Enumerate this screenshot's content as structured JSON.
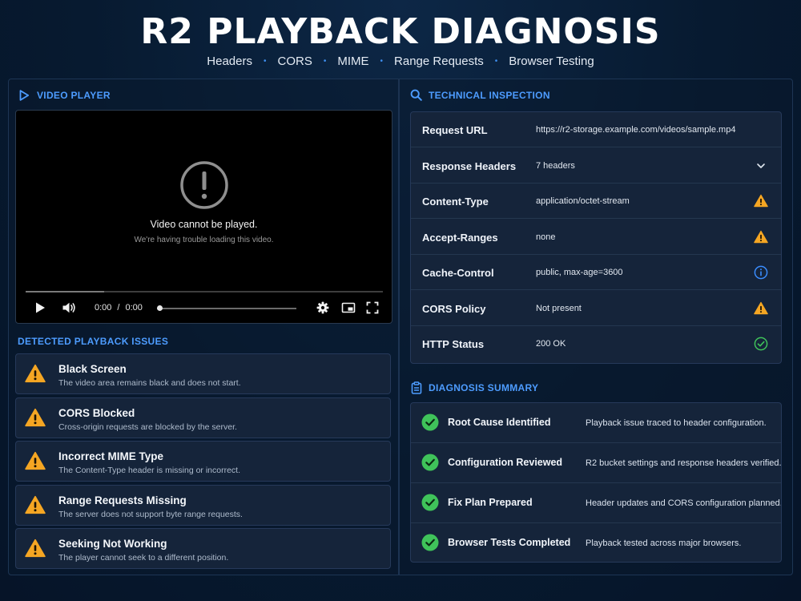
{
  "header": {
    "title": "R2 PLAYBACK DIAGNOSIS",
    "topics": [
      "Headers",
      "CORS",
      "MIME",
      "Range Requests",
      "Browser Testing"
    ],
    "separator": "•"
  },
  "video_player": {
    "section_label": "VIDEO PLAYER",
    "error_title": "Video cannot be played.",
    "error_subtitle": "We're having trouble loading this video.",
    "current_time": "0:00",
    "time_separator": "/",
    "duration": "0:00",
    "progress_fraction": 0.0,
    "buffered_fraction": 0.22
  },
  "issues": {
    "section_label": "DETECTED PLAYBACK ISSUES",
    "items": [
      {
        "title": "Black Screen",
        "description": "The video area remains black and does not start.",
        "icon": "warning-icon"
      },
      {
        "title": "CORS Blocked",
        "description": "Cross-origin requests are blocked by the server.",
        "icon": "warning-icon"
      },
      {
        "title": "Incorrect MIME Type",
        "description": "The Content-Type header is missing or incorrect.",
        "icon": "warning-icon"
      },
      {
        "title": "Range Requests Missing",
        "description": "The server does not support byte range requests.",
        "icon": "warning-icon"
      },
      {
        "title": "Seeking Not Working",
        "description": "The player cannot seek to a different position.",
        "icon": "warning-icon"
      }
    ]
  },
  "inspection": {
    "section_label": "TECHNICAL INSPECTION",
    "rows": [
      {
        "key": "Request URL",
        "value": "https://r2-storage.example.com/videos/sample.mp4",
        "status": ""
      },
      {
        "key": "Response Headers",
        "value": "7 headers",
        "status": "chevron-down-icon"
      },
      {
        "key": "Content-Type",
        "value": "application/octet-stream",
        "status": "warning-icon"
      },
      {
        "key": "Accept-Ranges",
        "value": "none",
        "status": "warning-icon"
      },
      {
        "key": "Cache-Control",
        "value": "public, max-age=3600",
        "status": "info-icon"
      },
      {
        "key": "CORS Policy",
        "value": "Not present",
        "status": "warning-icon"
      },
      {
        "key": "HTTP Status",
        "value": "200 OK",
        "status": "check-circle-icon"
      }
    ]
  },
  "summary": {
    "section_label": "DIAGNOSIS SUMMARY",
    "items": [
      {
        "title": "Root Cause Identified",
        "description": "Playback issue traced to header configuration."
      },
      {
        "title": "Configuration Reviewed",
        "description": "R2 bucket settings and response headers verified."
      },
      {
        "title": "Fix Plan Prepared",
        "description": "Header updates and CORS configuration planned."
      },
      {
        "title": "Browser Tests Completed",
        "description": "Playback tested across major browsers."
      }
    ]
  },
  "colors": {
    "accent": "#4d9cff",
    "warning": "#f5a623",
    "success": "#3fc35a",
    "info": "#3a8dff",
    "background": "#071a30"
  }
}
